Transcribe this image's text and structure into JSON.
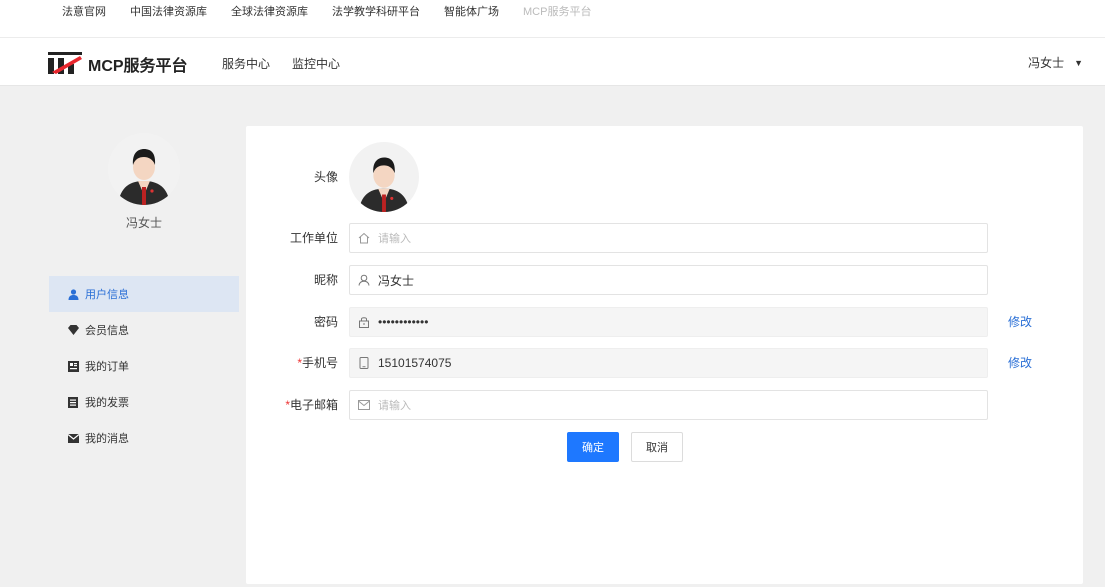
{
  "top_links": [
    {
      "label": "法意官网"
    },
    {
      "label": "中国法律资源库"
    },
    {
      "label": "全球法律资源库"
    },
    {
      "label": "法学教学科研平台"
    },
    {
      "label": "智能体广场"
    },
    {
      "label": "MCP服务平台"
    }
  ],
  "header": {
    "brand": "MCP服务平台",
    "nav": [
      {
        "label": "服务中心"
      },
      {
        "label": "监控中心"
      }
    ],
    "user_name": "冯女士",
    "caret": "▼"
  },
  "sidebar": {
    "user_name": "冯女士",
    "items": [
      {
        "label": "用户信息",
        "icon": "user-icon",
        "active": true
      },
      {
        "label": "会员信息",
        "icon": "diamond-icon"
      },
      {
        "label": "我的订单",
        "icon": "order-icon"
      },
      {
        "label": "我的发票",
        "icon": "invoice-icon"
      },
      {
        "label": "我的消息",
        "icon": "mail-icon"
      }
    ]
  },
  "form": {
    "avatar_label": "头像",
    "work_unit": {
      "label": "工作单位",
      "value": "",
      "placeholder": "请输入"
    },
    "nickname": {
      "label": "昵称",
      "value": "冯女士",
      "placeholder": ""
    },
    "password": {
      "label": "密码",
      "value": "••••••••••••",
      "modify": "修改"
    },
    "phone": {
      "required_mark": "*",
      "label": "手机号",
      "value": "15101574075",
      "modify": "修改"
    },
    "email": {
      "required_mark": "*",
      "label": "电子邮箱",
      "value": "",
      "placeholder": "请输入"
    },
    "confirm_label": "确定",
    "cancel_label": "取消"
  },
  "colors": {
    "accent": "#1e78ff",
    "link": "#2a6fd6",
    "active_bg": "#dde6f3",
    "required": "#e33333"
  }
}
